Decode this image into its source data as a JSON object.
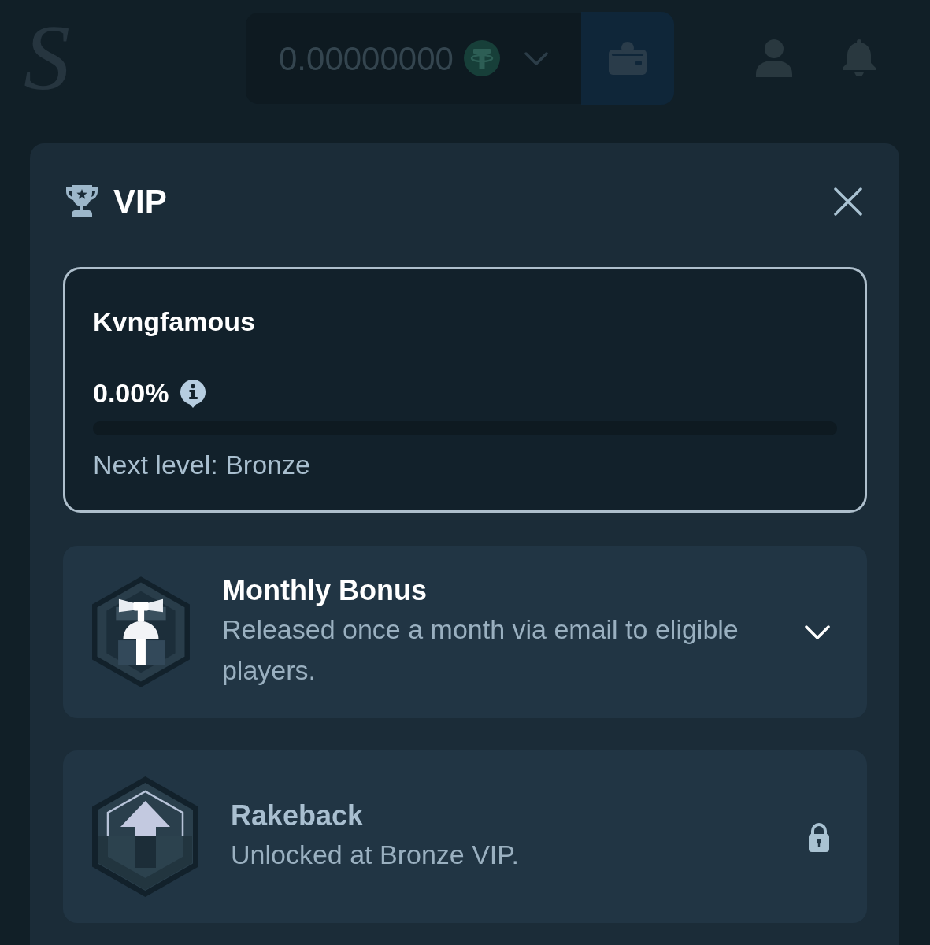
{
  "top_bar": {
    "logo": "S",
    "balance": "0.00000000"
  },
  "modal": {
    "title": "VIP",
    "profile": {
      "username": "Kvngfamous",
      "progress_text": "0.00%",
      "level": 0,
      "next_level": "Next level: Bronze"
    },
    "benefits": [
      {
        "kind": "gift",
        "title": "Monthly Bonus",
        "description": "Released once a month via email to eligible players.",
        "locked": false,
        "expanded": false
      },
      {
        "kind": "arrow",
        "title": "Rakeback",
        "description": "Unlocked at Bronze VIP.",
        "locked": true
      }
    ]
  }
}
